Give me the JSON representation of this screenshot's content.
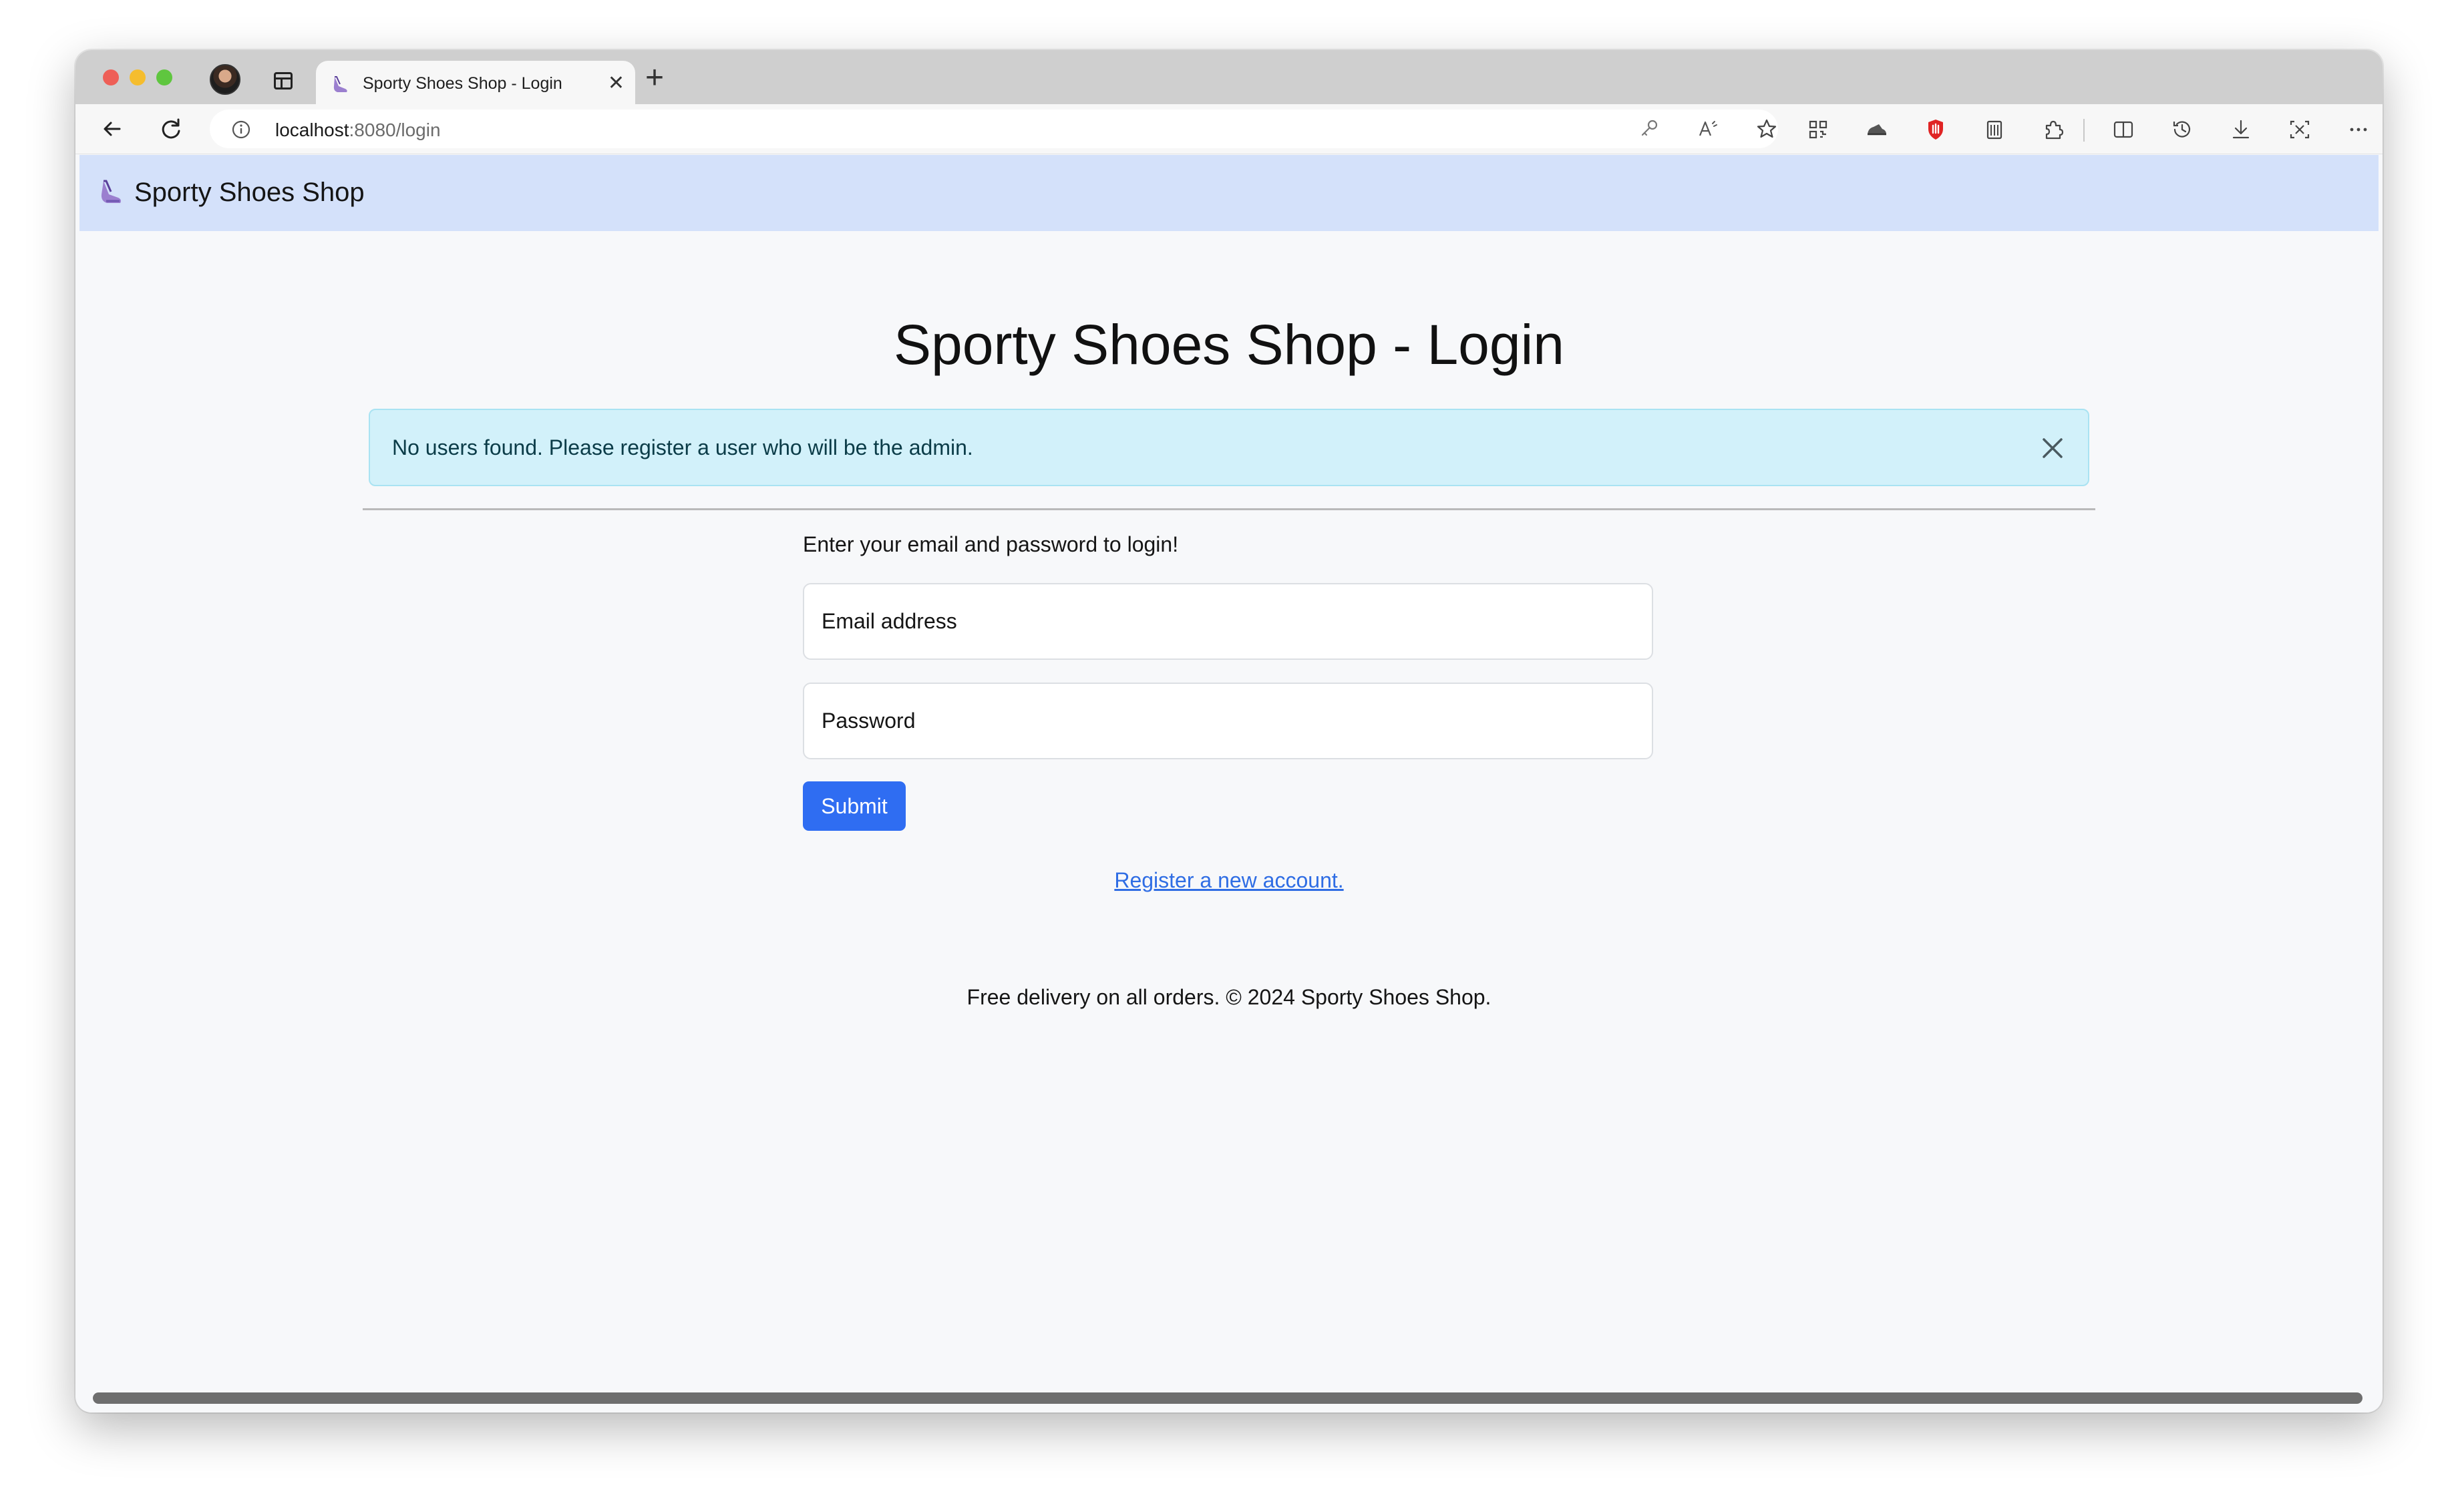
{
  "browser": {
    "tab": {
      "title": "Sporty Shoes Shop - Login",
      "close_glyph": "✕"
    },
    "new_tab_glyph": "+",
    "url_host": "localhost",
    "url_rest": ":8080/login"
  },
  "navbar": {
    "brand": "Sporty Shoes Shop"
  },
  "main": {
    "title": "Sporty Shoes Shop - Login",
    "alert": "No users found. Please register a user who will be the admin.",
    "hint": "Enter your email and password to login!",
    "email_placeholder": "Email address",
    "password_placeholder": "Password",
    "submit_label": "Submit",
    "register_link": "Register a new account."
  },
  "footer": {
    "text": "Free delivery on all orders. © 2024 Sporty Shoes Shop."
  },
  "colors": {
    "navbar_bg": "#d4e1fa",
    "alert_bg": "#d2f1fa",
    "primary": "#2f6df2",
    "link": "#2f6de4"
  }
}
